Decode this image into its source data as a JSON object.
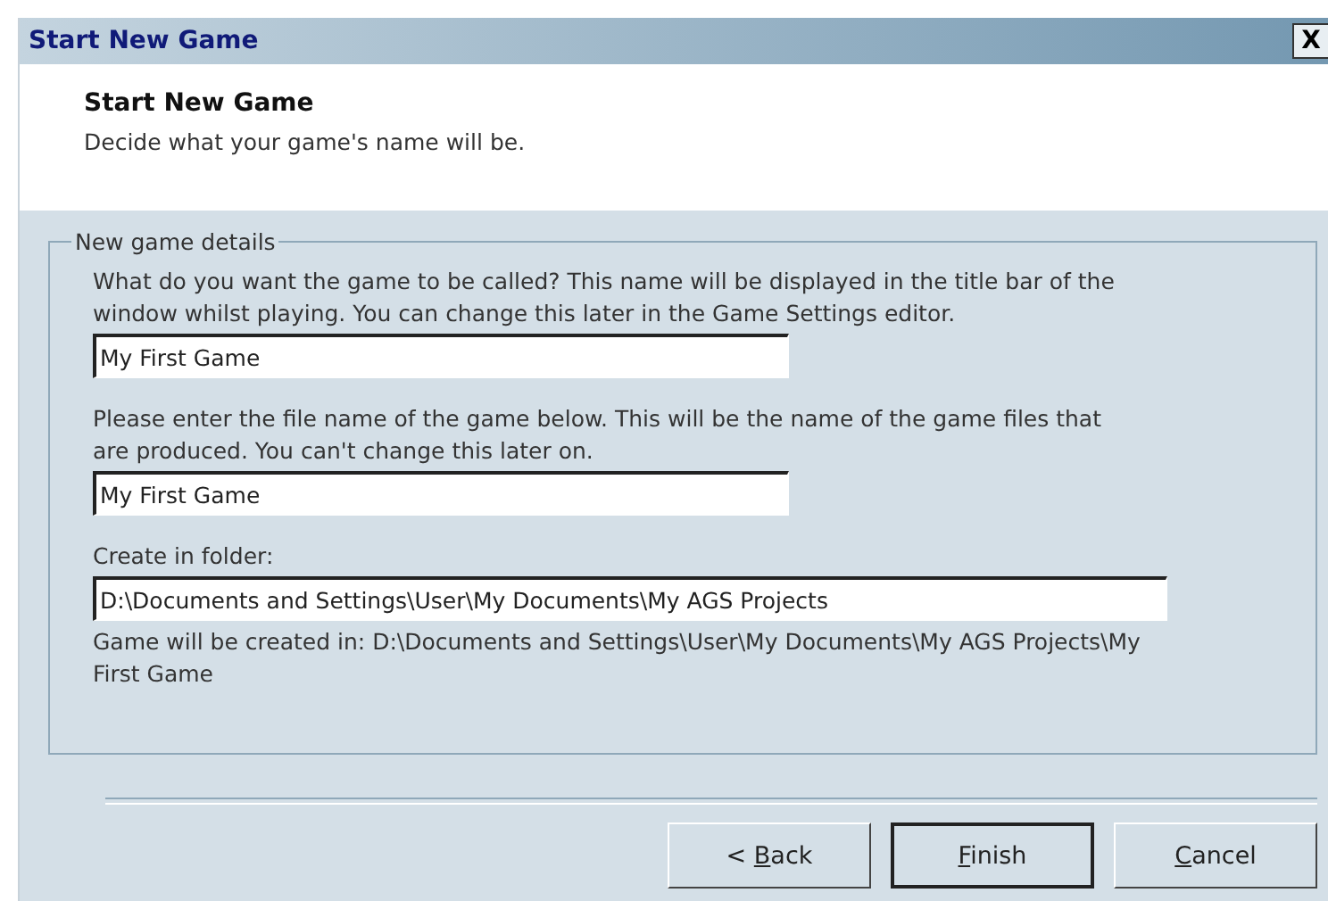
{
  "window": {
    "title": "Start New Game",
    "close_label": "X"
  },
  "header": {
    "title": "Start New Game",
    "subtitle": "Decide what your game's name will be."
  },
  "group": {
    "legend": "New game details",
    "fields": [
      {
        "label": "What do you want the game to be called? This name will be displayed in the title bar of the window whilst playing. You can change this later in the Game Settings editor.",
        "value": "My First Game",
        "wide": false
      },
      {
        "label": "Please enter the file name of the game below. This will be the name of the game files that are produced. You can't change this later on.",
        "value": "My First Game",
        "wide": false
      },
      {
        "label": "Create in folder:",
        "value": "D:\\Documents and Settings\\User\\My Documents\\My AGS Projects",
        "wide": true
      }
    ],
    "result": "Game will be created in: D:\\Documents and Settings\\User\\My Documents\\My AGS Projects\\My First Game"
  },
  "buttons": [
    {
      "label_before": "< ",
      "mnemonic": "B",
      "label_after": "ack",
      "default": false
    },
    {
      "mnemonic": "F",
      "label_after": "inish",
      "default": true
    },
    {
      "mnemonic": "C",
      "label_after": "ancel",
      "default": false
    }
  ]
}
